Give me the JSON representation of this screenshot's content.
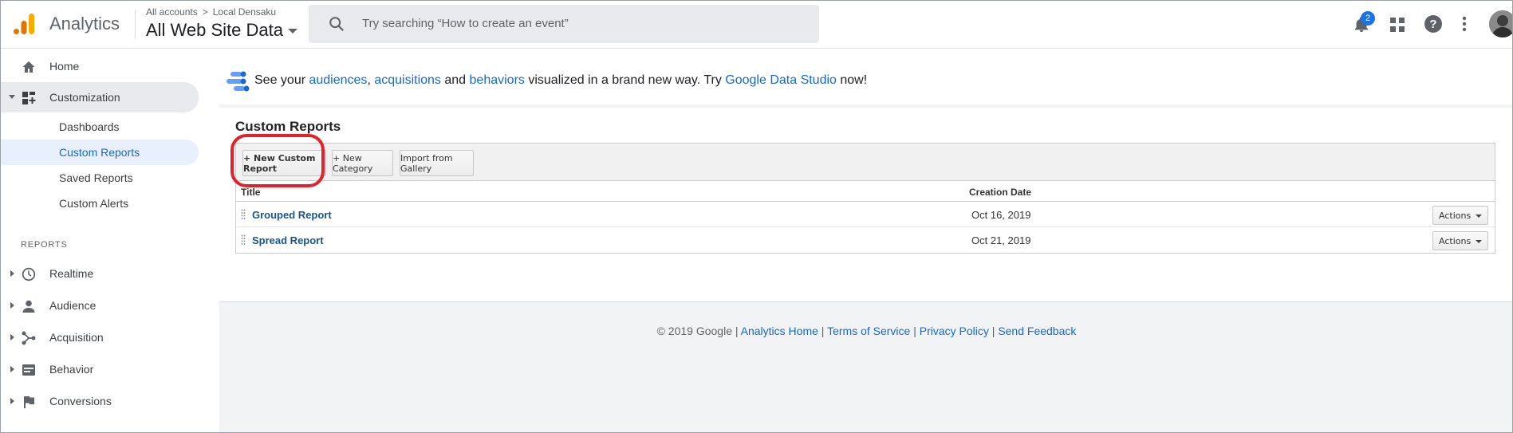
{
  "header": {
    "app_title": "Analytics",
    "breadcrumb": {
      "accounts": "All accounts",
      "separator": ">",
      "account": "Local Densaku"
    },
    "property": "All Web Site Data",
    "search_placeholder": "Try searching “How to create an event”",
    "notification_count": "2",
    "icons": [
      "search-icon",
      "bell-icon",
      "apps-grid-icon",
      "help-icon",
      "more-vert-icon"
    ],
    "colors": {
      "logo_orange": "#F9AB00",
      "logo_dark": "#E37400",
      "accent": "#1A73E8"
    }
  },
  "sidebar": {
    "items": [
      {
        "label": "Home",
        "icon": "home-icon"
      },
      {
        "label": "Customization",
        "icon": "dashboard-customize-icon"
      }
    ],
    "customization_sub": [
      {
        "label": "Dashboards"
      },
      {
        "label": "Custom Reports"
      },
      {
        "label": "Saved Reports"
      },
      {
        "label": "Custom Alerts"
      }
    ],
    "reports_header": "REPORTS",
    "reports": [
      {
        "label": "Realtime",
        "icon": "clock-icon"
      },
      {
        "label": "Audience",
        "icon": "person-icon"
      },
      {
        "label": "Acquisition",
        "icon": "acquisition-icon"
      },
      {
        "label": "Behavior",
        "icon": "behavior-icon"
      },
      {
        "label": "Conversions",
        "icon": "flag-icon"
      }
    ]
  },
  "banner": {
    "t1": "See your ",
    "l1": "audiences",
    "t2": ", ",
    "l2": "acquisitions",
    "t3": " and ",
    "l3": "behaviors",
    "t4": " visualized in a brand new way. Try ",
    "l4": "Google Data Studio",
    "t5": " now!"
  },
  "main": {
    "page_title": "Custom Reports",
    "toolbar": {
      "new_report": "+ New Custom Report",
      "new_category": "+ New Category",
      "import": "Import from Gallery"
    },
    "table": {
      "columns": [
        "Title",
        "Creation Date"
      ],
      "rows": [
        {
          "title": "Grouped Report",
          "date": "Oct 16, 2019",
          "actions": "Actions"
        },
        {
          "title": "Spread Report",
          "date": "Oct 21, 2019",
          "actions": "Actions"
        }
      ]
    }
  },
  "footer": {
    "copyright": "© 2019 Google",
    "sep": " | ",
    "links": [
      "Analytics Home",
      "Terms of Service",
      "Privacy Policy",
      "Send Feedback"
    ]
  }
}
